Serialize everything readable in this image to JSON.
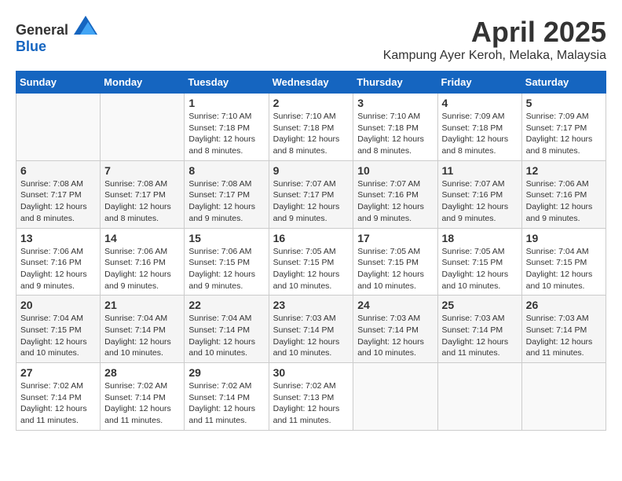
{
  "logo": {
    "general": "General",
    "blue": "Blue"
  },
  "header": {
    "title": "April 2025",
    "location": "Kampung Ayer Keroh, Melaka, Malaysia"
  },
  "weekdays": [
    "Sunday",
    "Monday",
    "Tuesday",
    "Wednesday",
    "Thursday",
    "Friday",
    "Saturday"
  ],
  "weeks": [
    [
      {
        "day": "",
        "info": ""
      },
      {
        "day": "",
        "info": ""
      },
      {
        "day": "1",
        "info": "Sunrise: 7:10 AM\nSunset: 7:18 PM\nDaylight: 12 hours and 8 minutes."
      },
      {
        "day": "2",
        "info": "Sunrise: 7:10 AM\nSunset: 7:18 PM\nDaylight: 12 hours and 8 minutes."
      },
      {
        "day": "3",
        "info": "Sunrise: 7:10 AM\nSunset: 7:18 PM\nDaylight: 12 hours and 8 minutes."
      },
      {
        "day": "4",
        "info": "Sunrise: 7:09 AM\nSunset: 7:18 PM\nDaylight: 12 hours and 8 minutes."
      },
      {
        "day": "5",
        "info": "Sunrise: 7:09 AM\nSunset: 7:17 PM\nDaylight: 12 hours and 8 minutes."
      }
    ],
    [
      {
        "day": "6",
        "info": "Sunrise: 7:08 AM\nSunset: 7:17 PM\nDaylight: 12 hours and 8 minutes."
      },
      {
        "day": "7",
        "info": "Sunrise: 7:08 AM\nSunset: 7:17 PM\nDaylight: 12 hours and 8 minutes."
      },
      {
        "day": "8",
        "info": "Sunrise: 7:08 AM\nSunset: 7:17 PM\nDaylight: 12 hours and 9 minutes."
      },
      {
        "day": "9",
        "info": "Sunrise: 7:07 AM\nSunset: 7:17 PM\nDaylight: 12 hours and 9 minutes."
      },
      {
        "day": "10",
        "info": "Sunrise: 7:07 AM\nSunset: 7:16 PM\nDaylight: 12 hours and 9 minutes."
      },
      {
        "day": "11",
        "info": "Sunrise: 7:07 AM\nSunset: 7:16 PM\nDaylight: 12 hours and 9 minutes."
      },
      {
        "day": "12",
        "info": "Sunrise: 7:06 AM\nSunset: 7:16 PM\nDaylight: 12 hours and 9 minutes."
      }
    ],
    [
      {
        "day": "13",
        "info": "Sunrise: 7:06 AM\nSunset: 7:16 PM\nDaylight: 12 hours and 9 minutes."
      },
      {
        "day": "14",
        "info": "Sunrise: 7:06 AM\nSunset: 7:16 PM\nDaylight: 12 hours and 9 minutes."
      },
      {
        "day": "15",
        "info": "Sunrise: 7:06 AM\nSunset: 7:15 PM\nDaylight: 12 hours and 9 minutes."
      },
      {
        "day": "16",
        "info": "Sunrise: 7:05 AM\nSunset: 7:15 PM\nDaylight: 12 hours and 10 minutes."
      },
      {
        "day": "17",
        "info": "Sunrise: 7:05 AM\nSunset: 7:15 PM\nDaylight: 12 hours and 10 minutes."
      },
      {
        "day": "18",
        "info": "Sunrise: 7:05 AM\nSunset: 7:15 PM\nDaylight: 12 hours and 10 minutes."
      },
      {
        "day": "19",
        "info": "Sunrise: 7:04 AM\nSunset: 7:15 PM\nDaylight: 12 hours and 10 minutes."
      }
    ],
    [
      {
        "day": "20",
        "info": "Sunrise: 7:04 AM\nSunset: 7:15 PM\nDaylight: 12 hours and 10 minutes."
      },
      {
        "day": "21",
        "info": "Sunrise: 7:04 AM\nSunset: 7:14 PM\nDaylight: 12 hours and 10 minutes."
      },
      {
        "day": "22",
        "info": "Sunrise: 7:04 AM\nSunset: 7:14 PM\nDaylight: 12 hours and 10 minutes."
      },
      {
        "day": "23",
        "info": "Sunrise: 7:03 AM\nSunset: 7:14 PM\nDaylight: 12 hours and 10 minutes."
      },
      {
        "day": "24",
        "info": "Sunrise: 7:03 AM\nSunset: 7:14 PM\nDaylight: 12 hours and 10 minutes."
      },
      {
        "day": "25",
        "info": "Sunrise: 7:03 AM\nSunset: 7:14 PM\nDaylight: 12 hours and 11 minutes."
      },
      {
        "day": "26",
        "info": "Sunrise: 7:03 AM\nSunset: 7:14 PM\nDaylight: 12 hours and 11 minutes."
      }
    ],
    [
      {
        "day": "27",
        "info": "Sunrise: 7:02 AM\nSunset: 7:14 PM\nDaylight: 12 hours and 11 minutes."
      },
      {
        "day": "28",
        "info": "Sunrise: 7:02 AM\nSunset: 7:14 PM\nDaylight: 12 hours and 11 minutes."
      },
      {
        "day": "29",
        "info": "Sunrise: 7:02 AM\nSunset: 7:14 PM\nDaylight: 12 hours and 11 minutes."
      },
      {
        "day": "30",
        "info": "Sunrise: 7:02 AM\nSunset: 7:13 PM\nDaylight: 12 hours and 11 minutes."
      },
      {
        "day": "",
        "info": ""
      },
      {
        "day": "",
        "info": ""
      },
      {
        "day": "",
        "info": ""
      }
    ]
  ]
}
